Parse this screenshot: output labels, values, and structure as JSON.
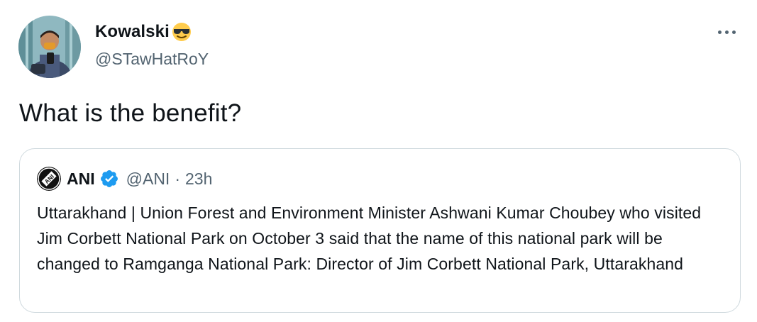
{
  "tweet": {
    "author": {
      "display_name": "Kowalski",
      "handle": "@STawHatRoY",
      "avatar_icon": "user-avatar-photo",
      "badge_emoji_icon": "sunglasses-emoji-icon"
    },
    "more_icon": "more-horizontal-icon",
    "text": "What is the benefit?"
  },
  "quoted_tweet": {
    "author": {
      "display_name": "ANI",
      "handle": "@ANI",
      "avatar_icon": "ani-logo",
      "verified_icon": "verified-badge-icon"
    },
    "separator": "·",
    "time": "23h",
    "text": "Uttarakhand | Union Forest and Environment Minister Ashwani Kumar Choubey who visited Jim Corbett National Park on October 3 said that the name of this national park will be changed to Ramganga National Park: Director of Jim Corbett National Park, Uttarakhand"
  },
  "colors": {
    "text_primary": "#0f1419",
    "text_secondary": "#536471",
    "border": "#cfd9de",
    "verified_blue": "#1d9bf0"
  }
}
